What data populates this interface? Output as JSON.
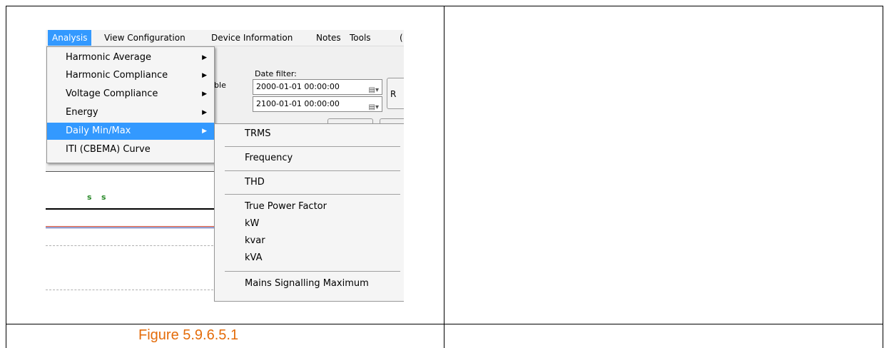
{
  "menubar": {
    "items": [
      "Analysis",
      "View Configuration",
      "Device Information",
      "Notes",
      "Tools",
      "("
    ]
  },
  "panel": {
    "date_filter_label": "Date filter:",
    "truncated_label": "table",
    "date_from": "2000-01-01 00:00:00",
    "date_to": "2100-01-01 00:00:00",
    "button_fragment": "R",
    "plot_marks": [
      "s",
      "s"
    ]
  },
  "analysis_menu": {
    "items": [
      {
        "label": "Harmonic Average",
        "submenu": true
      },
      {
        "label": "Harmonic Compliance",
        "submenu": true
      },
      {
        "label": "Voltage Compliance",
        "submenu": true
      },
      {
        "label": "Energy",
        "submenu": true
      },
      {
        "label": "Daily Min/Max",
        "submenu": true,
        "active": true
      },
      {
        "label": "ITI (CBEMA) Curve",
        "submenu": false
      }
    ]
  },
  "daily_submenu": {
    "items": [
      "TRMS",
      "Frequency",
      "THD",
      "True Power Factor",
      "kW",
      "kvar",
      "kVA",
      "Mains Signalling Maximum"
    ]
  },
  "icons": {
    "submenu_arrow": "triangle-right-icon",
    "calendar": "calendar-dropdown-icon"
  },
  "colors": {
    "highlight": "#3399ff",
    "caption": "#e46c0a",
    "plot_mark": "#2b8a2b"
  },
  "caption": "Figure 5.9.6.5.1"
}
